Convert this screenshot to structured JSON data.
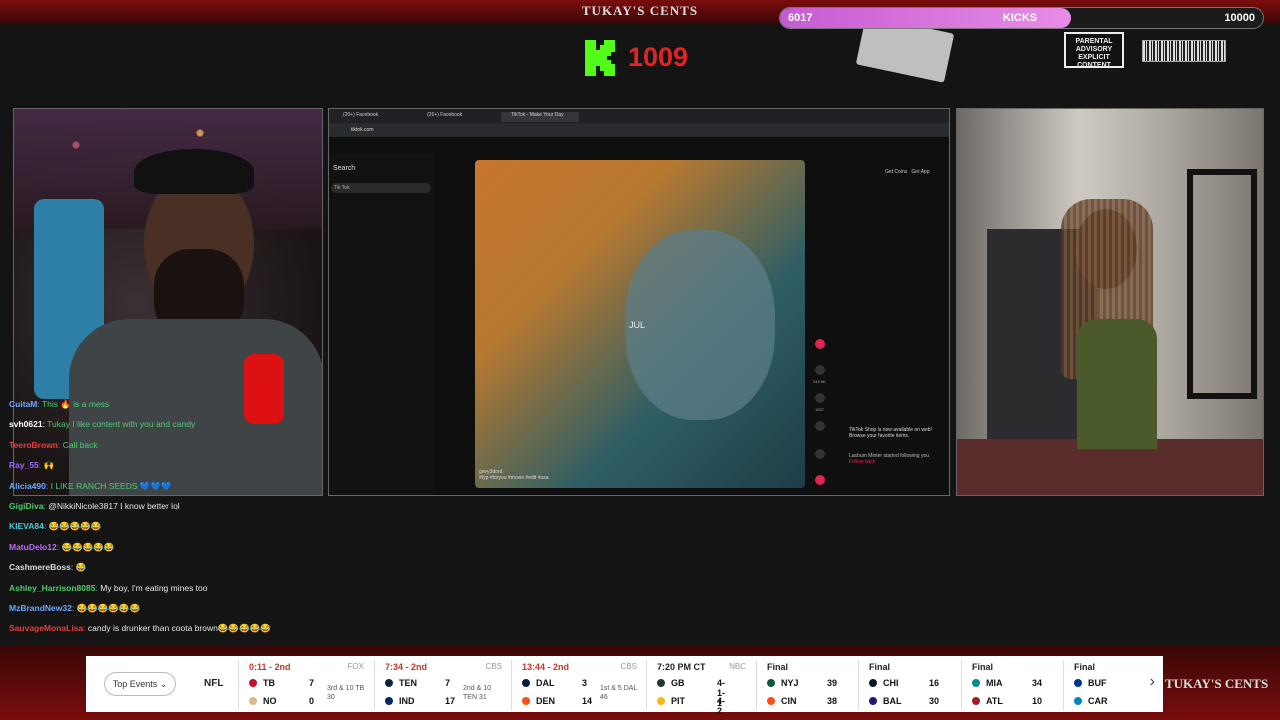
{
  "brand": "TUKAY'S CENTS",
  "goal": {
    "current": "6017",
    "label": "KICKS",
    "max": "10000",
    "fraction": 0.6017
  },
  "kick_count": "1009",
  "parental_advisory": "PARENTAL ADVISORY EXPLICIT CONTENT",
  "browser": {
    "tabs": [
      "(20+) Facebook",
      "(26+) Facebook",
      "TikTok - Make Your Day"
    ],
    "url": "tiktok.com",
    "search_title": "Search",
    "search_value": "Tik Tok",
    "video_overlay_text": "JUL",
    "video_caption": "#fyp #foryou #movie #edit #usa",
    "video_user": "gevy3dord",
    "get_coins": "Get Coins",
    "get_app": "Get App",
    "shop_note": "TikTok Shop is now available on web! Browse your favorite items.",
    "follower_note": "Lasbum Minter started following you",
    "follow_back": "Follow back",
    "likes": "249.6K",
    "comments": "1537"
  },
  "chat": [
    {
      "user": "CuitaM",
      "text": "This 🔥 is a mess",
      "color": "#6ea8ff"
    },
    {
      "user": "svh0621",
      "text": "Tukay I like content with you and candy",
      "color": "#ffffff"
    },
    {
      "user": "TeeroBrown",
      "text": "Call back",
      "color": "#e24040"
    },
    {
      "user": "Ray_55",
      "text": "🙌",
      "color": "#9b6bff"
    },
    {
      "user": "Alicia490",
      "text": "I LIKE RANCH SEEDS 💙💙💙",
      "color": "#6ea8ff"
    },
    {
      "user": "GigiDiva",
      "text": "@NikkiNicole3817 I know better lol",
      "color": "#4ecb71"
    },
    {
      "user": "KIEVA84",
      "text": "😂😂😂😂😂",
      "color": "#4ecbd9"
    },
    {
      "user": "MatuDelo12",
      "text": "😂😂😂😂😂",
      "color": "#c06bff"
    },
    {
      "user": "CashmereBoss",
      "text": "😂",
      "color": "#dddddd"
    },
    {
      "user": "Ashley_Harrison8085",
      "text": "My boy, I'm eating mines too",
      "color": "#4ecb71"
    },
    {
      "user": "MzBrandNew32",
      "text": "😂😂😂😂😂😂",
      "color": "#6ea8ff"
    },
    {
      "user": "SauvageMonaLisa",
      "text": "candy is drunker than coota brown😂😂😂😂😂",
      "color": "#e24040"
    }
  ],
  "ticker": {
    "top_events": "Top Events",
    "league": "NFL",
    "games": [
      {
        "status": "0:11 - 2nd",
        "network": "FOX",
        "away": "TB",
        "away_score": "7",
        "home": "NO",
        "home_score": "0",
        "info": "3rd & 10 TB 30",
        "status_color": "#c0392b"
      },
      {
        "status": "7:34 - 2nd",
        "network": "CBS",
        "away": "TEN",
        "away_score": "7",
        "home": "IND",
        "home_score": "17",
        "info": "2nd & 10 TEN 31",
        "status_color": "#c0392b"
      },
      {
        "status": "13:44 - 2nd",
        "network": "CBS",
        "away": "DAL",
        "away_score": "3",
        "home": "DEN",
        "home_score": "14",
        "info": "1st & 5 DAL 46",
        "status_color": "#c0392b"
      },
      {
        "status": "7:20 PM CT",
        "network": "NBC",
        "away": "GB",
        "away_score": "4-1-1",
        "home": "PIT",
        "home_score": "4-2",
        "info": "",
        "status_color": "#222"
      },
      {
        "status": "Final",
        "network": "",
        "away": "NYJ",
        "away_score": "39",
        "home": "CIN",
        "home_score": "38",
        "info": "",
        "status_color": "#222"
      },
      {
        "status": "Final",
        "network": "",
        "away": "CHI",
        "away_score": "16",
        "home": "BAL",
        "home_score": "30",
        "info": "",
        "status_color": "#222"
      },
      {
        "status": "Final",
        "network": "",
        "away": "MIA",
        "away_score": "34",
        "home": "ATL",
        "home_score": "10",
        "info": "",
        "status_color": "#222"
      },
      {
        "status": "Final",
        "network": "",
        "away": "BUF",
        "away_score": "",
        "home": "CAR",
        "home_score": "",
        "info": "",
        "status_color": "#222"
      }
    ],
    "team_colors": [
      "#c8102e",
      "#d3bc8d",
      "#0c2340",
      "#002c5f",
      "#041e42",
      "#fb4f14",
      "#203731",
      "#ffb612",
      "#125740",
      "#fb4f14",
      "#0b162a",
      "#241773",
      "#008e97",
      "#a71930",
      "#00338d",
      "#0085ca"
    ]
  }
}
